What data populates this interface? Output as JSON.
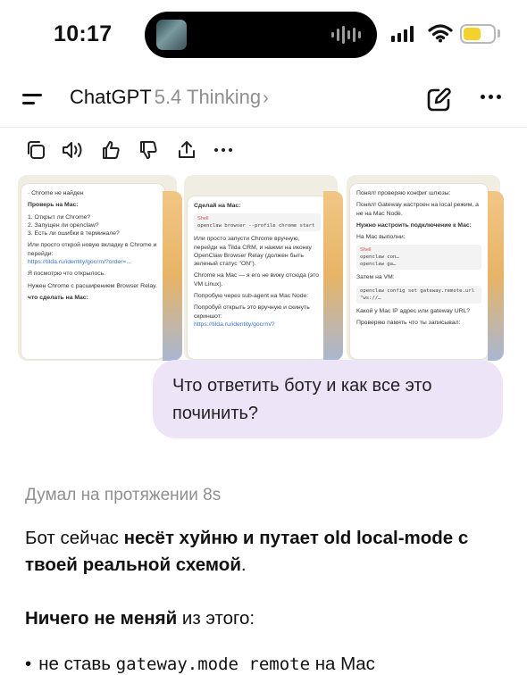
{
  "status_bar": {
    "time": "10:17",
    "battery_level": 0.6,
    "battery_color": "#f4d12b"
  },
  "header": {
    "app_name": "ChatGPT",
    "model": "5.4 Thinking",
    "chevron": "›",
    "icons": [
      "menu-icon",
      "edit-icon",
      "more-icon"
    ]
  },
  "message_actions": [
    "copy-icon",
    "read-aloud-icon",
    "thumbs-up-icon",
    "thumbs-down-icon",
    "share-icon",
    "more-icon"
  ],
  "screenshots": [
    {
      "top_text": "· Chrome не найден",
      "heading": "Проверь на Mac:",
      "items": [
        "1. Открыт ли Chrome?",
        "2. Запущен ли openclaw?",
        "3. Есть ли ошибки в терминале?"
      ],
      "para": "Или просто открой новую вкладку в Chrome и перейди:",
      "link": "https://tilda.ru/identity/gocrm/?order=...",
      "note": "Я посмотрю что открылось.",
      "need": "Нужен Chrome с расширением Browser Relay.",
      "footer": "что сделать на Mac:"
    },
    {
      "heading": "Сделай на Mac:",
      "shell_label": "Shell",
      "code": "openclaw browser --profile chrome start",
      "para": "Или просто запусти Chrome вручную, перейди на Tilda CRM, и нажми на иконку OpenClaw Browser Relay (должен быть зеленый статус \"ON\").",
      "note": "Chrome на Mac — я его не вижу отсюда (это VM Linux).",
      "try1": "Попробую через sub-agent на Mac Node:",
      "try2": "Попробуй открыть это вручную и скинуть скриншот:",
      "link": "https://tilda.ru/identity/gocrm/?"
    },
    {
      "top_text": "Понял! проверяю конфиг шлюзы:",
      "intro": "Понял! Gateway настроен на local режим, а не на Mac Node.",
      "heading": "Нужно настроить подключение к Mac:",
      "do_mac": "На Mac выполни:",
      "shell_label": "Shell",
      "code1": "openclaw con…",
      "code2": "openclaw ga…",
      "then_vm": "Затем на VM:",
      "code3": "openclaw config set gateway.remote.url \"ws://…",
      "ask": "Какой у Mac IP адрес или gateway URL?",
      "check": "Проверяю память что ты записывал:"
    }
  ],
  "user_message": "Что ответить боту и как все это починить?",
  "assistant": {
    "thought": "Думал на протяжении 8s",
    "p1_a": "Бот сейчас ",
    "p1_b": "несёт хуйню и путает old local-mode с твоей реальной схемой",
    "p1_c": ".",
    "p2_a": "Ничего не меняй",
    "p2_b": " из этого:",
    "bullet_a": "не ставь ",
    "bullet_code": "gateway.mode remote",
    "bullet_b": " на Mac"
  }
}
